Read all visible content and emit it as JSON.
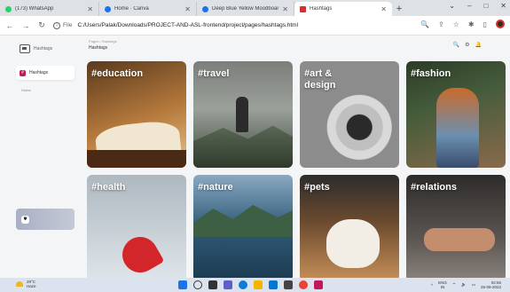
{
  "browser": {
    "tabs": [
      {
        "title": "(173) WhatsApp",
        "favicon_color": "#25d366",
        "active": false
      },
      {
        "title": "Home · Canva",
        "favicon_color": "#1a73e8",
        "active": false
      },
      {
        "title": "Deep Blue Yellow Moodboard Ph...",
        "favicon_color": "#1a73e8",
        "active": false
      },
      {
        "title": "Hashtags",
        "favicon_color": "#d32f2f",
        "active": true
      }
    ],
    "new_tab": "+",
    "window_controls": [
      "⌄",
      "–",
      "□",
      "✕"
    ],
    "address": {
      "scheme": "File",
      "url": "C:/Users/Palak/Downloads/PROJECT-AND-ASL-frontend/project/pages/hashtags.html"
    }
  },
  "sidebar": {
    "logo_text": "Hashtags",
    "active_item": "Hashtags",
    "small_text": "Home"
  },
  "main": {
    "breadcrumb": "Pages / Hashtags",
    "title": "Hashtags",
    "top_icons": [
      "🔍",
      "⚙",
      "🔔"
    ]
  },
  "categories": [
    {
      "label": "#education",
      "bg": "#b67a3c"
    },
    {
      "label": "#travel",
      "bg": "#6b6f68"
    },
    {
      "label": "#art & design",
      "bg": "#8e8e8e"
    },
    {
      "label": "#fashion",
      "bg": "#455c3b"
    },
    {
      "label": "#health",
      "bg": "#c9d2d8"
    },
    {
      "label": "#nature",
      "bg": "#2f5a78"
    },
    {
      "label": "#pets",
      "bg": "#c69059"
    },
    {
      "label": "#relations",
      "bg": "#5c5653"
    }
  ],
  "taskbar": {
    "weather_temp": "29°C",
    "weather_desc": "Haze",
    "lang": "ENG",
    "region": "IN",
    "time": "02:56",
    "date": "25-09-2022"
  }
}
